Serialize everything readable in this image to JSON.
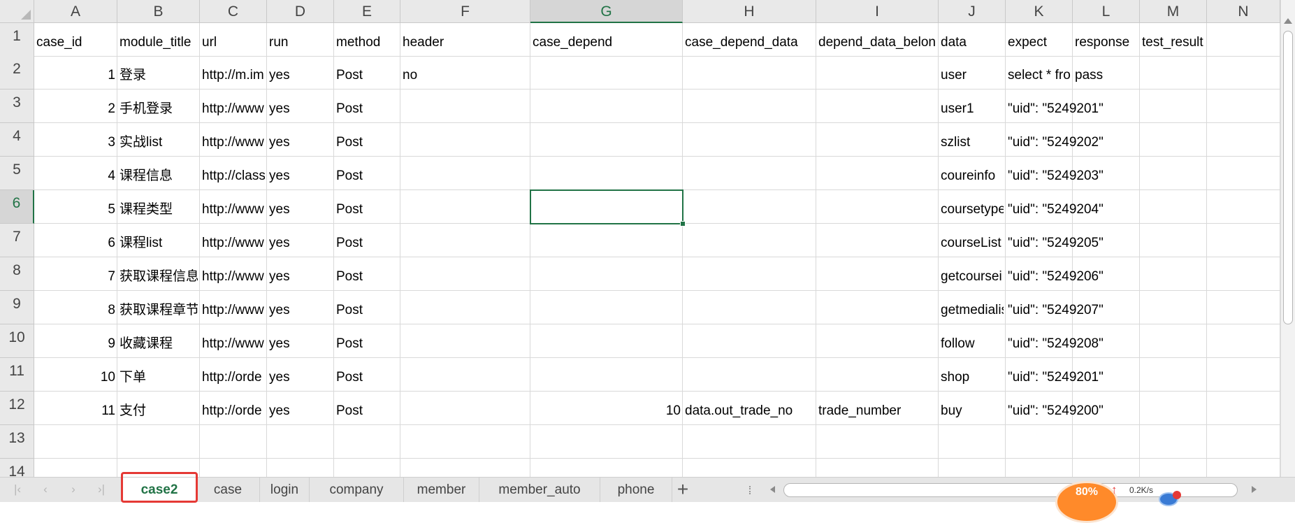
{
  "spreadsheet": {
    "selected_cell": "G6",
    "columns": [
      "A",
      "B",
      "C",
      "D",
      "E",
      "F",
      "G",
      "H",
      "I",
      "J",
      "K",
      "L",
      "M",
      "N"
    ],
    "rows": [
      "1",
      "2",
      "3",
      "4",
      "5",
      "6",
      "7",
      "8",
      "9",
      "10",
      "11",
      "12",
      "13",
      "14"
    ],
    "cells": [
      [
        "case_id",
        "module_title",
        "url",
        "run",
        "method",
        "header",
        "case_depend",
        "case_depend_data",
        "depend_data_belon",
        "data",
        "expect",
        "response",
        "test_result",
        ""
      ],
      [
        "1",
        "登录",
        "http://m.im",
        "yes",
        "Post",
        "no",
        "",
        "",
        "",
        "user",
        "select * fro",
        "pass",
        "",
        ""
      ],
      [
        "2",
        "手机登录",
        "http://www",
        "yes",
        "Post",
        "",
        "",
        "",
        "",
        "user1",
        "\"uid\": \"5249201\"",
        "",
        "",
        ""
      ],
      [
        "3",
        "实战list",
        "http://www",
        "yes",
        "Post",
        "",
        "",
        "",
        "",
        "szlist",
        "\"uid\": \"5249202\"",
        "",
        "",
        ""
      ],
      [
        "4",
        "课程信息",
        "http://class",
        "yes",
        "Post",
        "",
        "",
        "",
        "",
        "coureinfo",
        "\"uid\": \"5249203\"",
        "",
        "",
        ""
      ],
      [
        "5",
        "课程类型",
        "http://www",
        "yes",
        "Post",
        "",
        "",
        "",
        "",
        "coursetype",
        "\"uid\": \"5249204\"",
        "",
        "",
        ""
      ],
      [
        "6",
        "课程list",
        "http://www",
        "yes",
        "Post",
        "",
        "",
        "",
        "",
        "courseList",
        "\"uid\": \"5249205\"",
        "",
        "",
        ""
      ],
      [
        "7",
        "获取课程信息",
        "http://www",
        "yes",
        "Post",
        "",
        "",
        "",
        "",
        "getcoursei",
        "\"uid\": \"5249206\"",
        "",
        "",
        ""
      ],
      [
        "8",
        "获取课程章节",
        "http://www",
        "yes",
        "Post",
        "",
        "",
        "",
        "",
        "getmedialis",
        "\"uid\": \"5249207\"",
        "",
        "",
        ""
      ],
      [
        "9",
        "收藏课程",
        "http://www",
        "yes",
        "Post",
        "",
        "",
        "",
        "",
        "follow",
        "\"uid\": \"5249208\"",
        "",
        "",
        ""
      ],
      [
        "10",
        "下单",
        "http://orde",
        "yes",
        "Post",
        "",
        "",
        "",
        "",
        "shop",
        "\"uid\": \"5249201\"",
        "",
        "",
        ""
      ],
      [
        "11",
        "支付",
        "http://orde",
        "yes",
        "Post",
        "",
        "10",
        "data.out_trade_no",
        "trade_number",
        "buy",
        "\"uid\": \"5249200\"",
        "",
        "",
        ""
      ],
      [
        "",
        "",
        "",
        "",
        "",
        "",
        "",
        "",
        "",
        "",
        "",
        "",
        "",
        ""
      ],
      [
        "",
        "",
        "",
        "",
        "",
        "",
        "",
        "",
        "",
        "",
        "",
        "",
        "",
        ""
      ]
    ]
  },
  "sheet_tabs": {
    "active_index": 0,
    "tabs": [
      "case2",
      "case",
      "login",
      "company",
      "member",
      "member_auto",
      "phone"
    ],
    "add_symbol": "+"
  },
  "nav_glyphs": {
    "first": "|‹",
    "prev": "‹",
    "next": "›",
    "last": "›|"
  },
  "network_widget": {
    "percent": "80%",
    "arrow": "↑",
    "speed": "0.2K/s"
  },
  "colors": {
    "accent": "#217346",
    "highlight_box": "#e53935",
    "widget_orange": "#ff8a2a"
  }
}
